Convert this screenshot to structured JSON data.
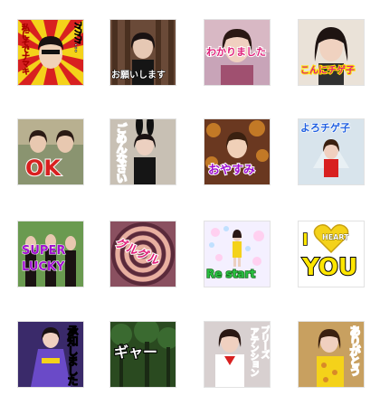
{
  "stickers": [
    {
      "id": 1,
      "caption": "ﾌｧﾌｧﾌｧ…",
      "caption2": "私にそでナマキ"
    },
    {
      "id": 2,
      "caption": "お願いします"
    },
    {
      "id": 3,
      "caption": "わかりました"
    },
    {
      "id": 4,
      "caption": "こんにチゲ子"
    },
    {
      "id": 5,
      "caption": "OK"
    },
    {
      "id": 6,
      "caption": "ごめんなさい"
    },
    {
      "id": 7,
      "caption": "おやすみ"
    },
    {
      "id": 8,
      "caption": "よろチゲ子"
    },
    {
      "id": 9,
      "caption": "SUPER",
      "caption2": "LUCKY"
    },
    {
      "id": 10,
      "caption": "グルグル"
    },
    {
      "id": 11,
      "caption": "Re start"
    },
    {
      "id": 12,
      "caption": "I",
      "caption2": "HEART",
      "caption3": "YOU"
    },
    {
      "id": 13,
      "caption": "承知しました"
    },
    {
      "id": 14,
      "caption": "ギャー"
    },
    {
      "id": 15,
      "caption": "プリーズ",
      "caption2": "アテンション"
    },
    {
      "id": 16,
      "caption": "ありがとう"
    }
  ],
  "colors": {
    "sunburst_red": "#d82020",
    "sunburst_yellow": "#f4d21a",
    "caption_pink": "#e0207a",
    "caption_purple": "#a010d0",
    "caption_blue": "#2060e0",
    "caption_orange": "#f07010",
    "caption_green": "#28c040",
    "caption_yellow": "#ffe600"
  },
  "icons": [
    "heart-icon"
  ]
}
